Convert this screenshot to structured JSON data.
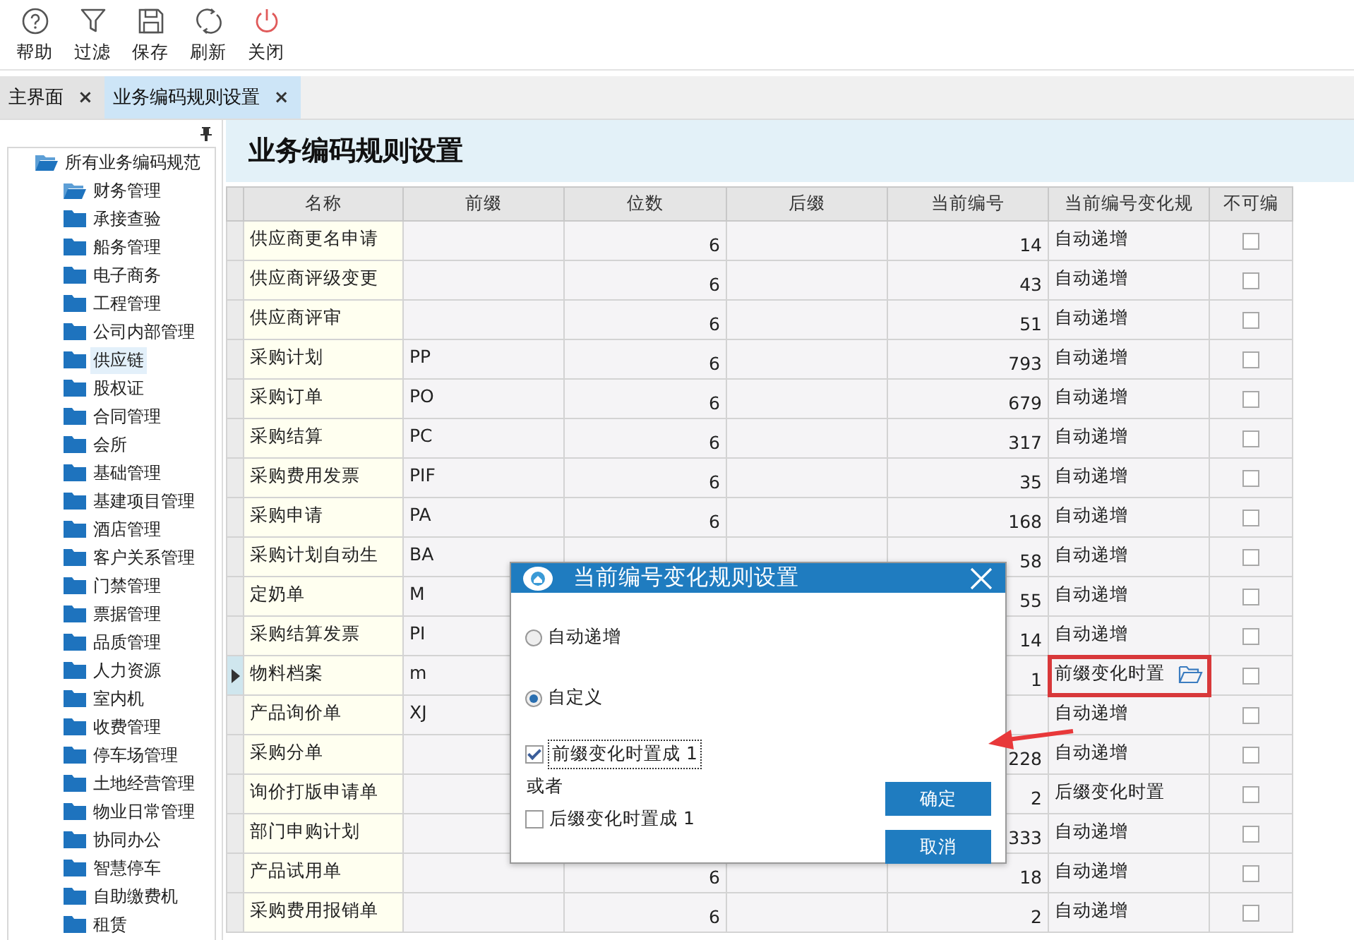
{
  "toolbar": [
    {
      "kind": "help",
      "label": "帮助"
    },
    {
      "kind": "filter",
      "label": "过滤"
    },
    {
      "kind": "save",
      "label": "保存"
    },
    {
      "kind": "refresh",
      "label": "刷新"
    },
    {
      "kind": "close",
      "label": "关闭"
    }
  ],
  "tabs": [
    {
      "label": "主界面",
      "close": "×",
      "selected": false
    },
    {
      "label": "业务编码规则设置",
      "close": "×",
      "selected": true
    }
  ],
  "sidebar": {
    "tree": [
      {
        "label": "所有业务编码规范",
        "expanded": true,
        "selected": false,
        "children": [
          {
            "label": "财务管理",
            "expanded": true,
            "selected": false
          },
          {
            "label": "承接查验",
            "expanded": false,
            "selected": false
          },
          {
            "label": "船务管理",
            "expanded": false,
            "selected": false
          },
          {
            "label": "电子商务",
            "expanded": false,
            "selected": false
          },
          {
            "label": "工程管理",
            "expanded": false,
            "selected": false
          },
          {
            "label": "公司内部管理",
            "expanded": false,
            "selected": false
          },
          {
            "label": "供应链",
            "expanded": false,
            "selected": true
          },
          {
            "label": "股权证",
            "expanded": false,
            "selected": false
          },
          {
            "label": "合同管理",
            "expanded": false,
            "selected": false
          },
          {
            "label": "会所",
            "expanded": false,
            "selected": false
          },
          {
            "label": "基础管理",
            "expanded": false,
            "selected": false
          },
          {
            "label": "基建项目管理",
            "expanded": false,
            "selected": false
          },
          {
            "label": "酒店管理",
            "expanded": false,
            "selected": false
          },
          {
            "label": "客户关系管理",
            "expanded": false,
            "selected": false
          },
          {
            "label": "门禁管理",
            "expanded": false,
            "selected": false
          },
          {
            "label": "票据管理",
            "expanded": false,
            "selected": false
          },
          {
            "label": "品质管理",
            "expanded": false,
            "selected": false
          },
          {
            "label": "人力资源",
            "expanded": false,
            "selected": false
          },
          {
            "label": "室内机",
            "expanded": false,
            "selected": false
          },
          {
            "label": "收费管理",
            "expanded": false,
            "selected": false
          },
          {
            "label": "停车场管理",
            "expanded": false,
            "selected": false
          },
          {
            "label": "土地经营管理",
            "expanded": false,
            "selected": false
          },
          {
            "label": "物业日常管理",
            "expanded": false,
            "selected": false
          },
          {
            "label": "协同办公",
            "expanded": false,
            "selected": false
          },
          {
            "label": "智慧停车",
            "expanded": false,
            "selected": false
          },
          {
            "label": "自助缴费机",
            "expanded": false,
            "selected": false
          },
          {
            "label": "租赁",
            "expanded": false,
            "selected": false
          }
        ]
      }
    ]
  },
  "page_title": "业务编码规则设置",
  "table": {
    "columns": [
      "名称",
      "前缀",
      "位数",
      "后缀",
      "当前编号",
      "当前编号变化规",
      "不可编"
    ],
    "rows": [
      {
        "name": "供应商更名申请",
        "digits": "6",
        "current_number": "14",
        "rule": "自动递增",
        "not_editable": false,
        "current": false,
        "highlighted": false
      },
      {
        "name": "供应商评级变更",
        "digits": "6",
        "current_number": "43",
        "rule": "自动递增",
        "not_editable": false,
        "current": false,
        "highlighted": false
      },
      {
        "name": "供应商评审",
        "digits": "6",
        "current_number": "51",
        "rule": "自动递增",
        "not_editable": false,
        "current": false,
        "highlighted": false
      },
      {
        "name": "采购计划",
        "prefix": "PP",
        "digits": "6",
        "current_number": "793",
        "rule": "自动递增",
        "not_editable": false,
        "current": false,
        "highlighted": false
      },
      {
        "name": "采购订单",
        "prefix": "PO",
        "digits": "6",
        "current_number": "679",
        "rule": "自动递增",
        "not_editable": false,
        "current": false,
        "highlighted": false
      },
      {
        "name": "采购结算",
        "prefix": "PC",
        "digits": "6",
        "current_number": "317",
        "rule": "自动递增",
        "not_editable": false,
        "current": false,
        "highlighted": false
      },
      {
        "name": "采购费用发票",
        "prefix": "PIF",
        "digits": "6",
        "current_number": "35",
        "rule": "自动递增",
        "not_editable": false,
        "current": false,
        "highlighted": false
      },
      {
        "name": "采购申请",
        "prefix": "PA",
        "digits": "6",
        "current_number": "168",
        "rule": "自动递增",
        "not_editable": false,
        "current": false,
        "highlighted": false
      },
      {
        "name": "采购计划自动生",
        "prefix": "BA",
        "current_number": "58",
        "rule": "自动递增",
        "not_editable": false,
        "current": false,
        "highlighted": false
      },
      {
        "name": "定奶单",
        "prefix": "M",
        "current_number": "55",
        "rule": "自动递增",
        "not_editable": false,
        "current": false,
        "highlighted": false
      },
      {
        "name": "采购结算发票",
        "prefix": "PI",
        "current_number": "14",
        "rule": "自动递增",
        "not_editable": false,
        "current": false,
        "highlighted": false
      },
      {
        "name": "物料档案",
        "prefix": "m",
        "current_number": "1",
        "rule": "前缀变化时置",
        "not_editable": false,
        "current": true,
        "highlighted": true
      },
      {
        "name": "产品询价单",
        "prefix": "XJ",
        "rule": "自动递增",
        "not_editable": false,
        "current": false,
        "highlighted": false
      },
      {
        "name": "采购分单",
        "current_number": "228",
        "rule": "自动递增",
        "not_editable": false,
        "current": false,
        "highlighted": false
      },
      {
        "name": "询价打版申请单",
        "current_number": "2",
        "rule": "后缀变化时置",
        "not_editable": false,
        "current": false,
        "highlighted": false
      },
      {
        "name": "部门申购计划",
        "current_number": "333",
        "rule": "自动递增",
        "not_editable": false,
        "current": false,
        "highlighted": false
      },
      {
        "name": "产品试用单",
        "digits": "6",
        "current_number": "18",
        "rule": "自动递增",
        "not_editable": false,
        "current": false,
        "highlighted": false
      },
      {
        "name": "采购费用报销单",
        "digits": "6",
        "current_number": "2",
        "rule": "自动递增",
        "not_editable": false,
        "current": false,
        "highlighted": false
      }
    ]
  },
  "dialog": {
    "title": "当前编号变化规则设置",
    "options": [
      {
        "label": "自动递增",
        "selected": false
      },
      {
        "label": "自定义",
        "selected": true
      }
    ],
    "checkboxes": [
      {
        "label": "前缀变化时置成 1",
        "checked": true
      },
      {
        "label": "后缀变化时置成 1",
        "checked": false
      }
    ],
    "separator": "或者",
    "buttons": [
      "确定",
      "取消"
    ]
  }
}
